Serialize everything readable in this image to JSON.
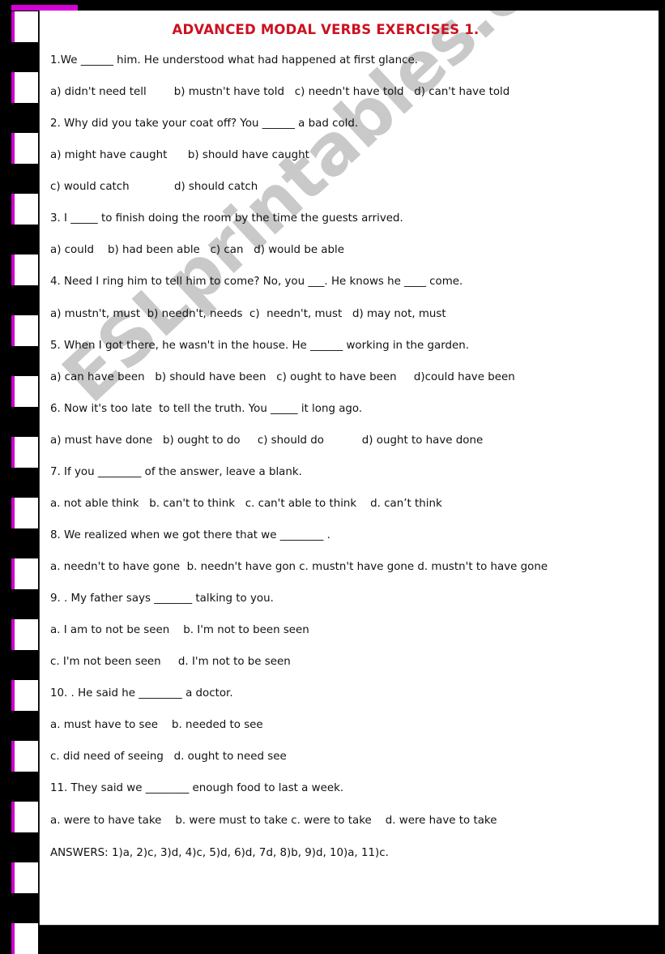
{
  "document": {
    "title": "ADVANCED MODAL VERBS EXERCISES 1.",
    "watermark": "ESLprintables.com",
    "accent_color": "#cc00cc",
    "title_color": "#cc1122",
    "watermark_color": "#c9c9c9",
    "page_background": "#ffffff",
    "frame_background": "#000000"
  },
  "exercises": [
    {
      "prompt": "1.We ______ him. He understood what had happened at first glance.",
      "options": [
        "a) didn't need tell        b) mustn't have told   c) needn't have told   d) can't have told"
      ]
    },
    {
      "prompt": "2. Why did you take your coat off? You ______ a bad cold.",
      "options": [
        "a) might have caught      b) should have caught",
        "c) would catch             d) should catch"
      ]
    },
    {
      "prompt": "3. I _____ to finish doing the room by the time the guests arrived.",
      "options": [
        "a) could    b) had been able   c) can   d) would be able"
      ]
    },
    {
      "prompt": "4. Need I ring him to tell him to come? No, you ___. He knows he ____ come.",
      "options": [
        "a) mustn't, must  b) needn't, needs  c)  needn't, must   d) may not, must"
      ]
    },
    {
      "prompt": "5. When I got there, he wasn't in the house. He ______ working in the garden.",
      "options": [
        "a) can have been   b) should have been   c) ought to have been     d)could have been"
      ]
    },
    {
      "prompt": "6. Now it's too late  to tell the truth. You _____ it long ago.",
      "options": [
        "a) must have done   b) ought to do     c) should do           d) ought to have done"
      ]
    },
    {
      "prompt": "7. If you ________ of the answer, leave a blank.",
      "options": [
        "a. not able think   b. can't to think   c. can't able to think    d. can’t think"
      ]
    },
    {
      "prompt": "8. We realized when we got there that we ________ .",
      "options": [
        "a. needn't to have gone  b. needn't have gon c. mustn't have gone d. mustn't to have gone"
      ]
    },
    {
      "prompt": "9. . My father says _______ talking to you.",
      "options": [
        "a. I am to not be seen    b. I'm not to been seen",
        "c. I'm not been seen     d. I'm not to be seen"
      ]
    },
    {
      "prompt": "10. . He said he ________ a doctor.",
      "options": [
        "a. must have to see    b. needed to see",
        "c. did need of seeing   d. ought to need see"
      ]
    },
    {
      "prompt": "11. They said we ________ enough food to last a week.",
      "options": [
        "a. were to have take    b. were must to take c. were to take    d. were have to take"
      ]
    }
  ],
  "answers": "ANSWERS: 1)a, 2)c, 3)d, 4)c, 5)d, 6)d, 7d, 8)b, 9)d, 10)a, 11)c."
}
